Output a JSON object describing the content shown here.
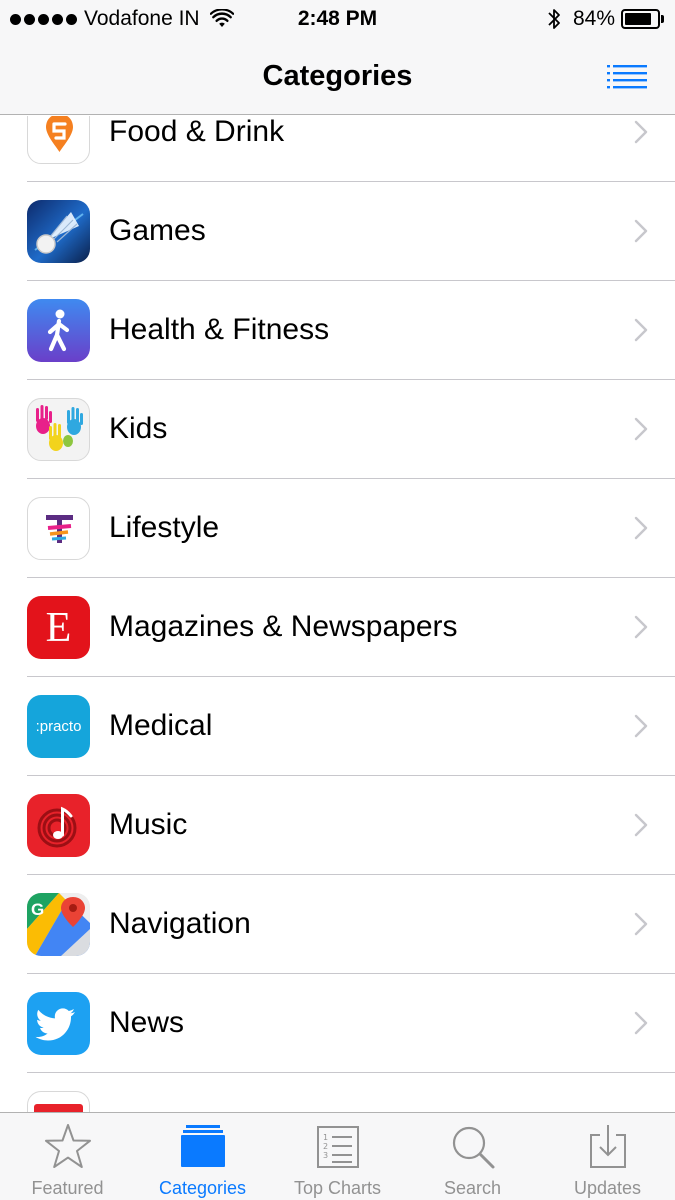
{
  "status_bar": {
    "carrier": "Vodafone IN",
    "time": "2:48 PM",
    "battery": "84%",
    "battery_level": 0.84
  },
  "nav": {
    "title": "Categories",
    "list_icon": "list-icon"
  },
  "categories": [
    {
      "label": "Food & Drink",
      "icon": "swiggy-app-icon"
    },
    {
      "label": "Games",
      "icon": "badminton-game-app-icon"
    },
    {
      "label": "Health & Fitness",
      "icon": "walking-person-app-icon"
    },
    {
      "label": "Kids",
      "icon": "painted-hands-app-icon"
    },
    {
      "label": "Lifestyle",
      "icon": "lifestyle-logo-app-icon"
    },
    {
      "label": "Magazines & Newspapers",
      "icon": "letter-e-app-icon",
      "icon_text": "E"
    },
    {
      "label": "Medical",
      "icon": "practo-app-icon",
      "icon_text": ":practo"
    },
    {
      "label": "Music",
      "icon": "music-note-app-icon"
    },
    {
      "label": "Navigation",
      "icon": "google-maps-app-icon"
    },
    {
      "label": "News",
      "icon": "twitter-bird-app-icon"
    }
  ],
  "tabs": [
    {
      "label": "Featured",
      "icon": "star-icon",
      "active": false
    },
    {
      "label": "Categories",
      "icon": "stacked-cards-icon",
      "active": true
    },
    {
      "label": "Top Charts",
      "icon": "ranked-list-icon",
      "active": false
    },
    {
      "label": "Search",
      "icon": "magnifier-icon",
      "active": false
    },
    {
      "label": "Updates",
      "icon": "download-tray-icon",
      "active": false
    }
  ],
  "colors": {
    "accent": "#0a7aff",
    "inactive_tab": "#929292",
    "chevron": "#c7c7cc",
    "separator": "#c8c7cc",
    "bar_background": "#f7f7f8"
  }
}
